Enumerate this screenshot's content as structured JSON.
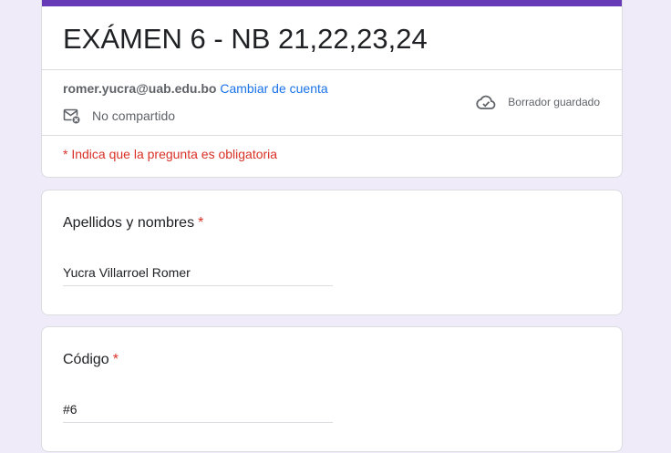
{
  "colors": {
    "background": "#f0ebf8",
    "accent": "#673ab7",
    "link": "#1a73e8",
    "required": "#d93025"
  },
  "form": {
    "title": "EXÁMEN 6 - NB 21,22,23,24",
    "account_email": "romer.yucra@uab.edu.bo",
    "switch_account": "Cambiar de cuenta",
    "share_status": "No compartido",
    "share_icon": "mail-not-shared-icon",
    "saved_status": "Borrador guardado",
    "saved_icon": "cloud-done-icon",
    "required_note": "* Indica que la pregunta es obligatoria"
  },
  "questions": [
    {
      "label": "Apellidos y nombres",
      "required_mark": "*",
      "answer": "Yucra Villarroel Romer"
    },
    {
      "label": "Código",
      "required_mark": "*",
      "answer": "#6"
    }
  ]
}
